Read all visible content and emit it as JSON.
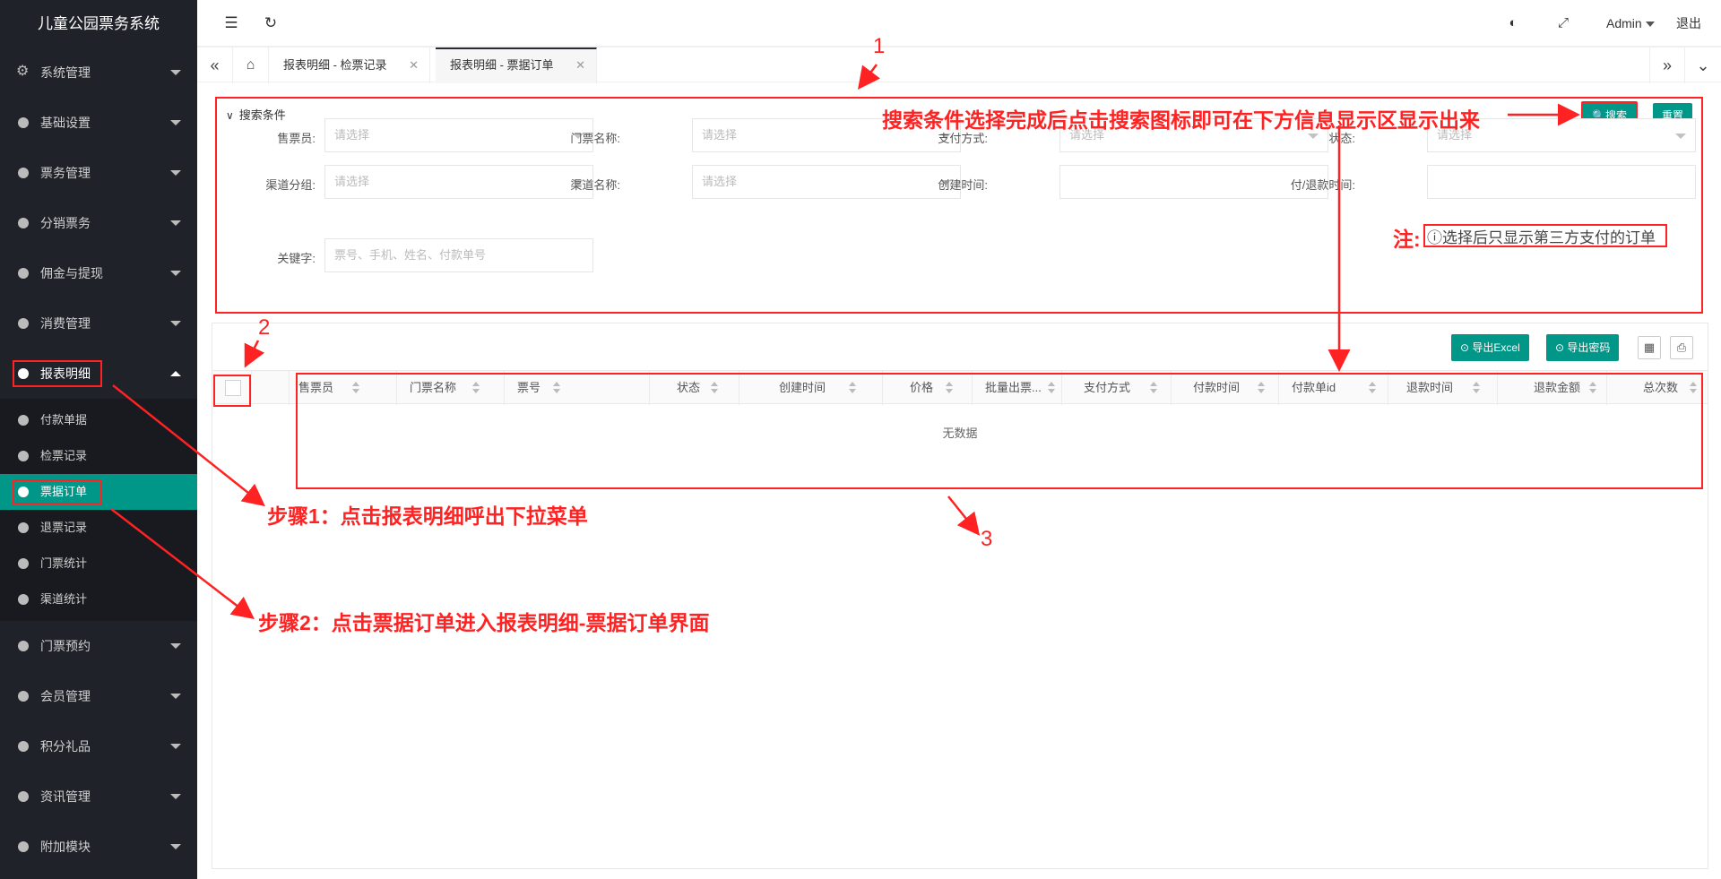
{
  "app": {
    "title": "儿童公园票务系统"
  },
  "sidebar": {
    "items": [
      {
        "label": "系统管理"
      },
      {
        "label": "基础设置"
      },
      {
        "label": "票务管理"
      },
      {
        "label": "分销票务"
      },
      {
        "label": "佣金与提现"
      },
      {
        "label": "消费管理"
      },
      {
        "label": "报表明细"
      },
      {
        "label": "门票预约"
      },
      {
        "label": "会员管理"
      },
      {
        "label": "积分礼品"
      },
      {
        "label": "资讯管理"
      },
      {
        "label": "附加模块"
      }
    ],
    "sub_items": [
      {
        "label": "付款单据"
      },
      {
        "label": "检票记录"
      },
      {
        "label": "票据订单"
      },
      {
        "label": "退票记录"
      },
      {
        "label": "门票统计"
      },
      {
        "label": "渠道统计"
      }
    ]
  },
  "header": {
    "user": "Admin",
    "logout": "退出"
  },
  "tabs": [
    {
      "label": "报表明细 - 检票记录"
    },
    {
      "label": "报表明细 - 票据订单"
    }
  ],
  "search": {
    "title": "搜索条件",
    "search_btn": "搜索",
    "reset_btn": "重置",
    "fields": {
      "seller": {
        "label": "售票员:",
        "placeholder": "请选择"
      },
      "ticket_name": {
        "label": "门票名称:",
        "placeholder": "请选择"
      },
      "pay_method": {
        "label": "支付方式:",
        "placeholder": "请选择"
      },
      "status": {
        "label": "状态:",
        "placeholder": "请选择"
      },
      "channel_group": {
        "label": "渠道分组:",
        "placeholder": "请选择"
      },
      "channel_name": {
        "label": "渠道名称:",
        "placeholder": "请选择"
      },
      "create_time": {
        "label": "创建时间:"
      },
      "pay_refund_time": {
        "label": "付/退款时间:"
      },
      "keyword": {
        "label": "关键字:",
        "placeholder": "票号、手机、姓名、付款单号"
      }
    }
  },
  "toolbar": {
    "export_excel": "导出Excel",
    "export_code": "导出密码"
  },
  "table": {
    "columns": [
      "售票员",
      "门票名称",
      "票号",
      "状态",
      "创建时间",
      "价格",
      "批量出票...",
      "支付方式",
      "付款时间",
      "付款单id",
      "退款时间",
      "退款金额",
      "总次数"
    ],
    "empty": "无数据"
  },
  "annotations": {
    "n1": "1",
    "n2": "2",
    "n3": "3",
    "search_hint": "搜索条件选择完成后点击搜索图标即可在下方信息显示区显示出来",
    "note_prefix": "注:",
    "note": "ⓘ选择后只显示第三方支付的订单",
    "step1": "步骤1：点击报表明细呼出下拉菜单",
    "step2": "步骤2：点击票据订单进入报表明细-票据订单界面"
  }
}
